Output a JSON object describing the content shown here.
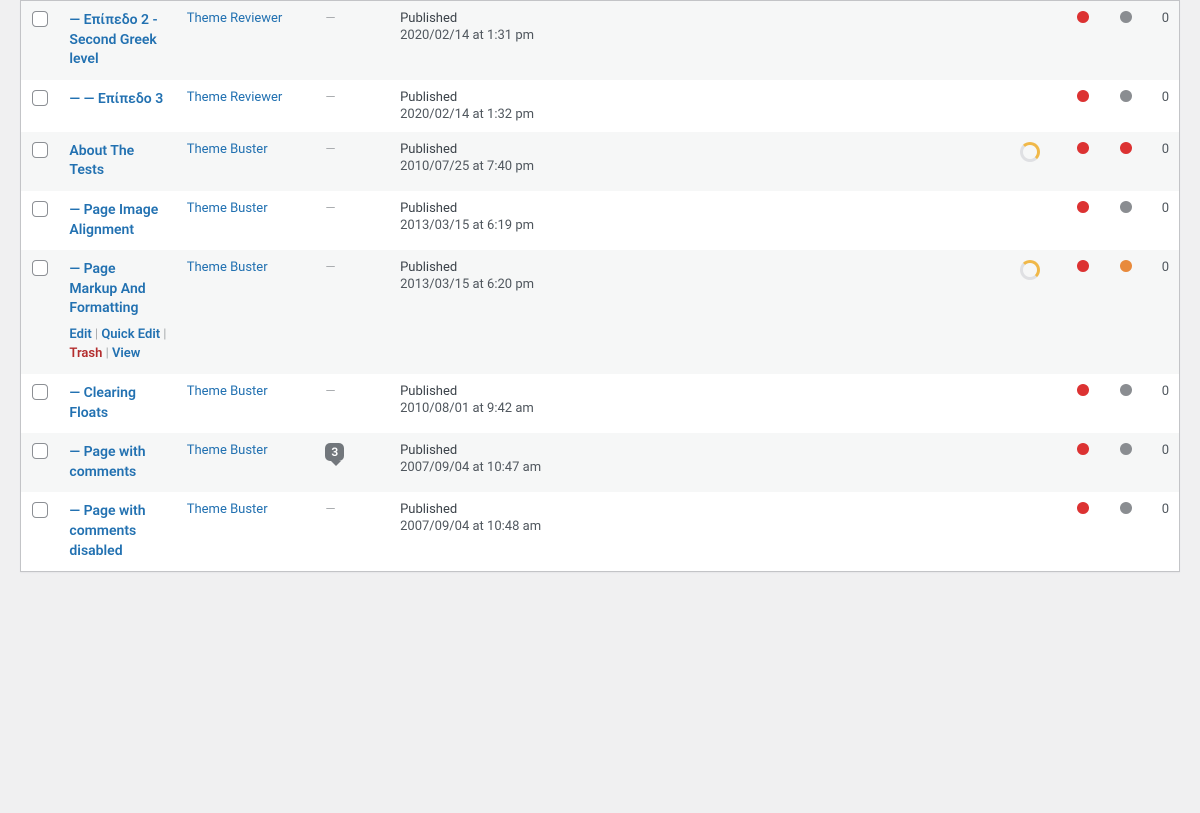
{
  "status_label": "Published",
  "row_actions": {
    "edit": "Edit",
    "quick_edit": "Quick Edit",
    "trash": "Trash",
    "view": "View"
  },
  "rows": [
    {
      "title": "— Επίπεδο 2 - Second Greek level",
      "author": "Theme Reviewer",
      "comments": null,
      "date": "2020/02/14 at 1:31 pm",
      "show_seo": false,
      "dot2": "gray",
      "count": "0",
      "alt": true,
      "show_actions": false
    },
    {
      "title": "— — Επίπεδο 3",
      "author": "Theme Reviewer",
      "comments": null,
      "date": "2020/02/14 at 1:32 pm",
      "show_seo": false,
      "dot2": "gray",
      "count": "0",
      "alt": false,
      "show_actions": false
    },
    {
      "title": "About The Tests",
      "author": "Theme Buster",
      "comments": null,
      "date": "2010/07/25 at 7:40 pm",
      "show_seo": true,
      "dot2": "red",
      "count": "0",
      "alt": true,
      "show_actions": false
    },
    {
      "title": "— Page Image Alignment",
      "author": "Theme Buster",
      "comments": null,
      "date": "2013/03/15 at 6:19 pm",
      "show_seo": false,
      "dot2": "gray",
      "count": "0",
      "alt": false,
      "show_actions": false
    },
    {
      "title": "— Page Markup And Formatting",
      "author": "Theme Buster",
      "comments": null,
      "date": "2013/03/15 at 6:20 pm",
      "show_seo": true,
      "dot2": "orange",
      "count": "0",
      "alt": true,
      "show_actions": true
    },
    {
      "title": "— Clearing Floats",
      "author": "Theme Buster",
      "comments": null,
      "date": "2010/08/01 at 9:42 am",
      "show_seo": false,
      "dot2": "gray",
      "count": "0",
      "alt": false,
      "show_actions": false
    },
    {
      "title": "— Page with comments",
      "author": "Theme Buster",
      "comments": "3",
      "date": "2007/09/04 at 10:47 am",
      "show_seo": false,
      "dot2": "gray",
      "count": "0",
      "alt": true,
      "show_actions": false
    },
    {
      "title": "— Page with comments disabled",
      "author": "Theme Buster",
      "comments": null,
      "date": "2007/09/04 at 10:48 am",
      "show_seo": false,
      "dot2": "gray",
      "count": "0",
      "alt": false,
      "show_actions": false
    }
  ]
}
